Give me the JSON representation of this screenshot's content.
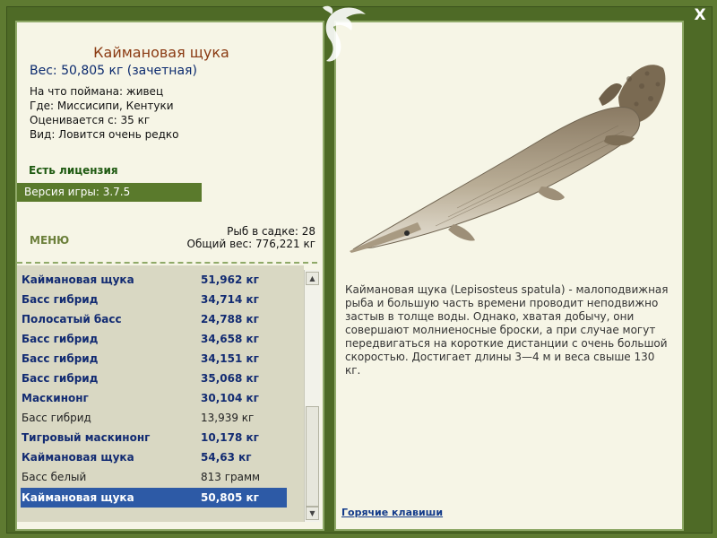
{
  "fish": {
    "title": "Каймановая щука",
    "weight": "Вес: 50,805 кг (зачетная)",
    "info": [
      "На что поймана: живец",
      "Где: Миссисипи, Кентуки",
      "Оценивается с: 35 кг",
      "Вид: Ловится очень редко"
    ],
    "license": "Есть лицензия",
    "version": "Версия игры: 3.7.5",
    "description": "Каймановая щука (Lepisosteus spatula) - малоподвижная рыба и большую часть времени проводит неподвижно застыв в толще воды. Однако, хватая добычу, они совершают молниеносные броски, а при случае могут передвигаться на короткие дистанции с очень большой скоростью. Достигает длины 3—4 м и веса свыше 130 кг."
  },
  "menu": {
    "label": "МЕНЮ"
  },
  "stats": {
    "fish_in_net": "Рыб в садке: 28",
    "total_weight": "Общий вес: 776,221 кг"
  },
  "catch_list": [
    {
      "name": "Каймановая щука",
      "weight": "51,962 кг",
      "bold": true
    },
    {
      "name": "Басс гибрид",
      "weight": "34,714 кг",
      "bold": true
    },
    {
      "name": "Полосатый басс",
      "weight": "24,788 кг",
      "bold": true
    },
    {
      "name": "Басс гибрид",
      "weight": "34,658 кг",
      "bold": true
    },
    {
      "name": "Басс гибрид",
      "weight": "34,151 кг",
      "bold": true
    },
    {
      "name": "Басс гибрид",
      "weight": "35,068 кг",
      "bold": true
    },
    {
      "name": "Маскинонг",
      "weight": "30,104 кг",
      "bold": true
    },
    {
      "name": "Басс гибрид",
      "weight": "13,939 кг",
      "bold": false
    },
    {
      "name": "Тигровый маскинонг",
      "weight": "10,178 кг",
      "bold": true
    },
    {
      "name": "Каймановая щука",
      "weight": "54,63 кг",
      "bold": true
    },
    {
      "name": "Басс белый",
      "weight": "813 грамм",
      "bold": false
    },
    {
      "name": "Каймановая щука",
      "weight": "50,805 кг",
      "bold": true,
      "selected": true
    }
  ],
  "hotkeys": {
    "label": "Горячие клавиши"
  },
  "close": {
    "label": "X"
  },
  "colors": {
    "frame": "#4e6a26",
    "panel": "#f6f5e6",
    "list_bg": "#d9d8c3",
    "selected": "#2d5aa6",
    "title": "#8a3a12",
    "weight": "#0b2a6e"
  },
  "icons": {
    "close": "close-icon",
    "logo": "dolphin-logo-icon",
    "scroll_up": "chevron-up-icon",
    "scroll_down": "chevron-down-icon"
  }
}
